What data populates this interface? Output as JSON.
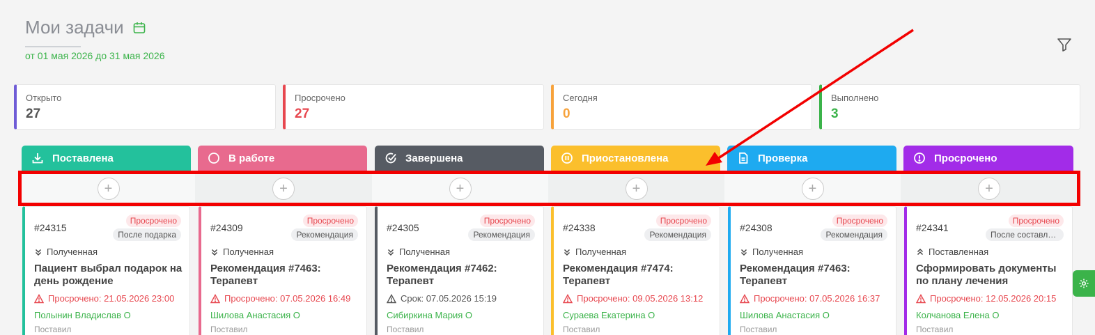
{
  "header": {
    "title": "Мои задачи",
    "date_range": "от 01 мая 2026 до 31 мая 2026"
  },
  "stats": [
    {
      "label": "Открыто",
      "value": "27",
      "color": "#6f5cd6"
    },
    {
      "label": "Просрочено",
      "value": "27",
      "color": "#e7474f"
    },
    {
      "label": "Сегодня",
      "value": "0",
      "color": "#f7a23b"
    },
    {
      "label": "Выполнено",
      "value": "3",
      "color": "#3bb34a"
    }
  ],
  "columns": [
    {
      "label": "Поставлена",
      "color": "#23c19c",
      "icon": "download-icon"
    },
    {
      "label": "В работе",
      "color": "#e86a8e",
      "icon": "circle-icon"
    },
    {
      "label": "Завершена",
      "color": "#565b63",
      "icon": "check-circle-icon"
    },
    {
      "label": "Приостановлена",
      "color": "#fbbf2c",
      "icon": "pause-icon"
    },
    {
      "label": "Проверка",
      "color": "#1eaaf0",
      "icon": "document-icon"
    },
    {
      "label": "Просрочено",
      "color": "#a22ce8",
      "icon": "alert-icon"
    }
  ],
  "add_button": "+",
  "cards": [
    {
      "id": "#24315",
      "badge_status": "Просрочено",
      "badge_type": "После подарка",
      "state": "Полученная",
      "state_icon": "chevrons-down-icon",
      "title": "Пациент выбрал подарок на день рождение",
      "due": "Просрочено: 21.05.2026 23:00",
      "due_overdue": true,
      "person": "Полынин Владислав О",
      "by": "Поставил",
      "color": "#23c19c"
    },
    {
      "id": "#24309",
      "badge_status": "Просрочено",
      "badge_type": "Рекомендация",
      "state": "Полученная",
      "state_icon": "chevrons-down-icon",
      "title": "Рекомендация #7463: Терапевт",
      "due": "Просрочено: 07.05.2026 16:49",
      "due_overdue": true,
      "person": "Шилова Анастасия О",
      "by": "Поставил",
      "color": "#e86a8e"
    },
    {
      "id": "#24305",
      "badge_status": "Просрочено",
      "badge_type": "Рекомендация",
      "state": "Полученная",
      "state_icon": "chevrons-down-icon",
      "title": "Рекомендация #7462: Терапевт",
      "due": "Срок: 07.05.2026 15:19",
      "due_overdue": false,
      "person": "Сибиркина Мария О",
      "by": "Поставил",
      "color": "#565b63"
    },
    {
      "id": "#24338",
      "badge_status": "Просрочено",
      "badge_type": "Рекомендация",
      "state": "Полученная",
      "state_icon": "chevrons-down-icon",
      "title": "Рекомендация #7474: Терапевт",
      "due": "Просрочено: 09.05.2026 13:12",
      "due_overdue": true,
      "person": "Сураева Екатерина О",
      "by": "Поставил",
      "color": "#fbbf2c"
    },
    {
      "id": "#24308",
      "badge_status": "Просрочено",
      "badge_type": "Рекомендация",
      "state": "Полученная",
      "state_icon": "chevrons-down-icon",
      "title": "Рекомендация #7463: Терапевт",
      "due": "Просрочено: 07.05.2026 16:37",
      "due_overdue": true,
      "person": "Шилова Анастасия О",
      "by": "Поставил",
      "color": "#1eaaf0"
    },
    {
      "id": "#24341",
      "badge_status": "Просрочено",
      "badge_type": "После составлен...",
      "state": "Поставленная",
      "state_icon": "chevrons-up-icon",
      "title": "Сформировать документы по плану лечения",
      "due": "Просрочено: 12.05.2026 20:15",
      "due_overdue": true,
      "person": "Колчанова Елена О",
      "by": "Поставил",
      "color": "#a22ce8"
    }
  ]
}
